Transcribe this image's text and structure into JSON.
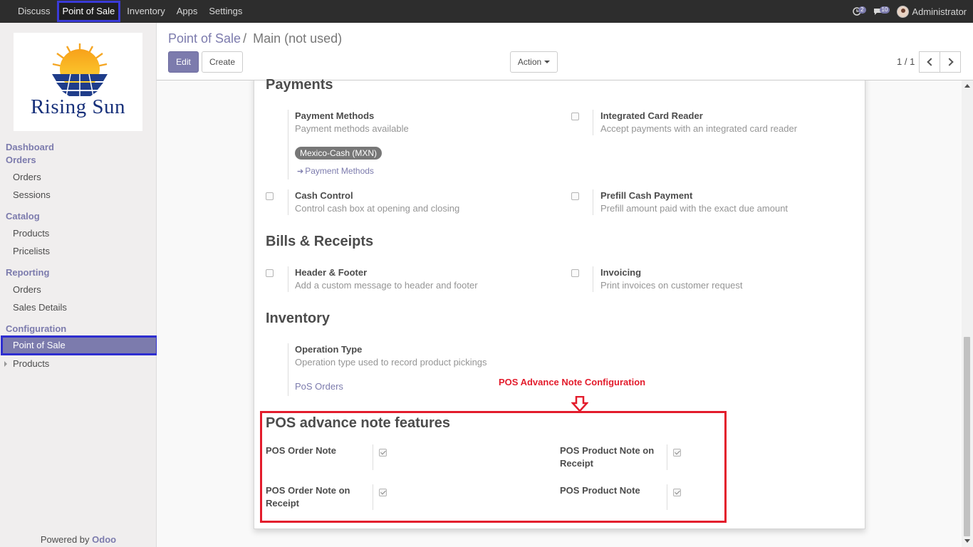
{
  "navbar": {
    "items": [
      "Discuss",
      "Point of Sale",
      "Inventory",
      "Apps",
      "Settings"
    ],
    "activity_count": "2",
    "messages_count": "10",
    "user": "Administrator"
  },
  "sidebar": {
    "logo_text": "Rising Sun",
    "dashboard": "Dashboard",
    "orders_section": "Orders",
    "orders_items": [
      "Orders",
      "Sessions"
    ],
    "catalog_section": "Catalog",
    "catalog_items": [
      "Products",
      "Pricelists"
    ],
    "reporting_section": "Reporting",
    "reporting_items": [
      "Orders",
      "Sales Details"
    ],
    "configuration_section": "Configuration",
    "configuration_active": "Point of Sale",
    "configuration_products": "Products",
    "powered_prefix": "Powered by ",
    "powered_brand": "Odoo"
  },
  "control": {
    "breadcrumb_parent": "Point of Sale",
    "breadcrumb_sep": "/",
    "breadcrumb_current": "Main (not used)",
    "edit": "Edit",
    "create": "Create",
    "action": "Action",
    "pager": "1 / 1"
  },
  "payments": {
    "heading": "Payments",
    "methods_title": "Payment Methods",
    "methods_desc": "Payment methods available",
    "methods_tag": "Mexico-Cash (MXN)",
    "methods_link": "Payment Methods",
    "card_title": "Integrated Card Reader",
    "card_desc": "Accept payments with an integrated card reader",
    "cash_title": "Cash Control",
    "cash_desc": "Control cash box at opening and closing",
    "prefill_title": "Prefill Cash Payment",
    "prefill_desc": "Prefill amount paid with the exact due amount"
  },
  "bills": {
    "heading": "Bills & Receipts",
    "header_title": "Header & Footer",
    "header_desc": "Add a custom message to header and footer",
    "invoicing_title": "Invoicing",
    "invoicing_desc": "Print invoices on customer request"
  },
  "inventory": {
    "heading": "Inventory",
    "op_title": "Operation Type",
    "op_desc": "Operation type used to record product pickings",
    "op_value": "PoS Orders"
  },
  "annotation": {
    "label": "POS Advance Note Configuration",
    "color": "#e31c2c"
  },
  "pos_notes": {
    "heading": "POS advance note features",
    "order_note": "POS Order Note",
    "order_note_receipt_1": "POS Order Note on",
    "order_note_receipt_2": "Receipt",
    "product_note_receipt_1": "POS Product Note on",
    "product_note_receipt_2": "Receipt",
    "product_note": "POS Product Note"
  },
  "colors": {
    "brand": "#7c7bad",
    "navbar": "#2d2d2d"
  }
}
